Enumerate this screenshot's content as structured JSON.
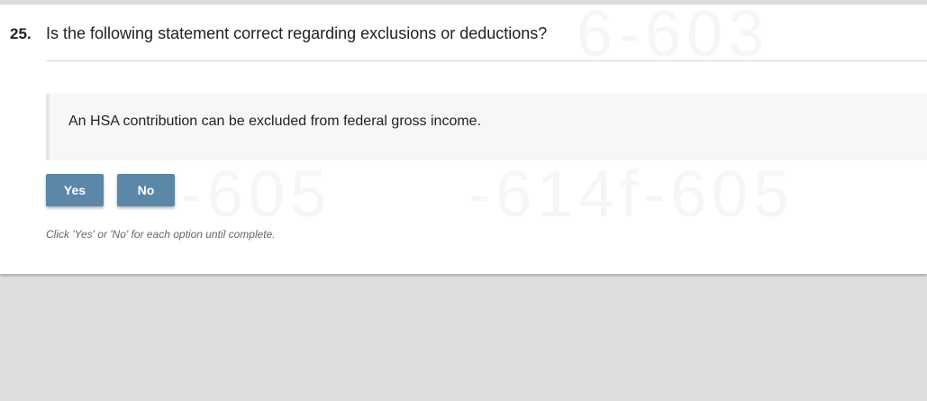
{
  "question": {
    "number": "25.",
    "text": "Is the following statement correct regarding exclusions or deductions?"
  },
  "statement": {
    "text": "An HSA contribution can be excluded from federal gross income."
  },
  "buttons": {
    "yes_label": "Yes",
    "no_label": "No"
  },
  "hint": "Click 'Yes' or 'No' for each option until complete.",
  "colors": {
    "button_bg": "#5b87a8",
    "button_text": "#ffffff",
    "page_bg": "#dedede",
    "card_bg": "#ffffff",
    "statement_bg": "#f7f7f7"
  }
}
